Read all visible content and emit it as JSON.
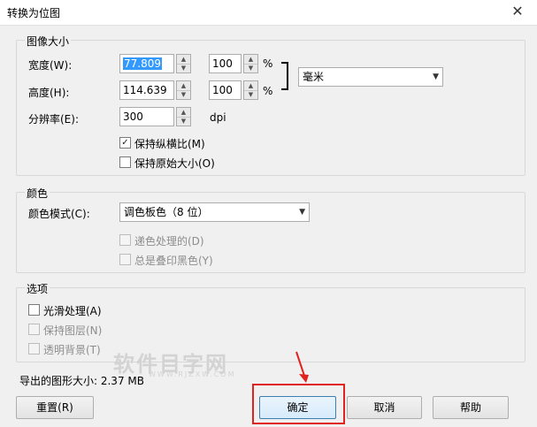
{
  "window": {
    "title": "转换为位图",
    "close_glyph": "✕"
  },
  "image_size": {
    "legend": "图像大小",
    "width_label": "宽度(W):",
    "width_value": "77.809",
    "width_percent": "100",
    "height_label": "高度(H):",
    "height_value": "114.639",
    "height_percent": "100",
    "percent_symbol": "%",
    "unit_select": "毫米",
    "resolution_label": "分辨率(E):",
    "resolution_value": "300",
    "resolution_unit": "dpi",
    "keep_ratio": {
      "label": "保持纵横比(M)",
      "checked": true
    },
    "keep_original": {
      "label": "保持原始大小(O)",
      "checked": false
    }
  },
  "color": {
    "legend": "颜色",
    "mode_label": "颜色模式(C):",
    "mode_value": "调色板色（8 位）",
    "dither": {
      "label": "递色处理的(D)",
      "checked": false,
      "disabled": true
    },
    "overprint": {
      "label": "总是叠印黑色(Y)",
      "checked": false,
      "disabled": true
    }
  },
  "options": {
    "legend": "选项",
    "antialias": {
      "label": "光滑处理(A)",
      "checked": false,
      "disabled": false
    },
    "keep_layers": {
      "label": "保持图层(N)",
      "checked": false,
      "disabled": true
    },
    "transparent_bg": {
      "label": "透明背景(T)",
      "checked": false,
      "disabled": true
    }
  },
  "export_size": "导出的图形大小: 2.37 MB",
  "buttons": {
    "reset": "重置(R)",
    "ok": "确定",
    "cancel": "取消",
    "help": "帮助"
  },
  "watermark": {
    "main": "软件目字网",
    "sub": "WWW.RJZXW.COM"
  },
  "annotation_color": "#e0231e"
}
